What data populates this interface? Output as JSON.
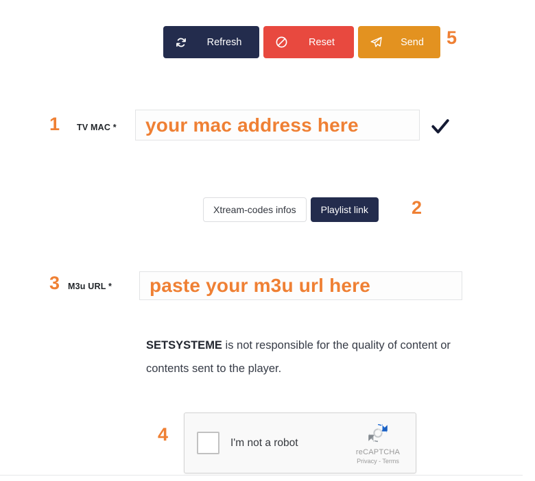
{
  "toolbar": {
    "buttons": [
      {
        "label": "Refresh",
        "icon": "refresh-icon",
        "color": "#232c4d"
      },
      {
        "label": "Reset",
        "icon": "ban-icon",
        "color": "#e8493f"
      },
      {
        "label": "Send",
        "icon": "paper-plane-icon",
        "color": "#e39220"
      }
    ]
  },
  "annotations": {
    "one": "1",
    "two": "2",
    "three": "3",
    "four": "4",
    "five": "5",
    "color": "#ef8034"
  },
  "mac_field": {
    "label": "TV MAC *",
    "placeholder": "your mac address here",
    "value": "",
    "valid_icon": "check-icon"
  },
  "source_toggle": {
    "options": [
      {
        "label": "Xtream-codes infos",
        "selected": false
      },
      {
        "label": "Playlist link",
        "selected": true
      }
    ]
  },
  "m3u_field": {
    "label": "M3u URL *",
    "placeholder": "paste your m3u url here",
    "value": ""
  },
  "disclaimer": {
    "brand": "SETSYSTEME",
    "text": " is not responsible for the quality of content or contents sent to the player."
  },
  "recaptcha": {
    "checkbox_label": "I'm not a robot",
    "brand": "reCAPTCHA",
    "links": "Privacy - Terms",
    "logo_icon": "recaptcha-logo-icon",
    "checked": false
  }
}
